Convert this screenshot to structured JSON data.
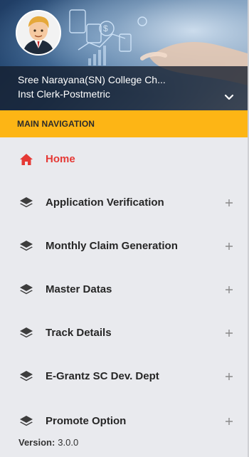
{
  "header": {
    "institution": "Sree Narayana(SN) College Ch...",
    "role": "Inst Clerk-Postmetric"
  },
  "section_title": "MAIN NAVIGATION",
  "menu": [
    {
      "label": "Home",
      "icon": "home-icon",
      "active": true,
      "expandable": false
    },
    {
      "label": "Application Verification",
      "icon": "layers-icon",
      "active": false,
      "expandable": true
    },
    {
      "label": "Monthly Claim Generation",
      "icon": "layers-icon",
      "active": false,
      "expandable": true
    },
    {
      "label": "Master Datas",
      "icon": "layers-icon",
      "active": false,
      "expandable": true
    },
    {
      "label": "Track Details",
      "icon": "layers-icon",
      "active": false,
      "expandable": true
    },
    {
      "label": "E-Grantz SC Dev. Dept",
      "icon": "layers-icon",
      "active": false,
      "expandable": true
    },
    {
      "label": "Promote Option",
      "icon": "layers-icon",
      "active": false,
      "expandable": true
    }
  ],
  "footer": {
    "version_label": "Version:",
    "version_value": "3.0.0"
  },
  "colors": {
    "accent": "#fdb515",
    "active": "#e53935",
    "text": "#262626"
  }
}
